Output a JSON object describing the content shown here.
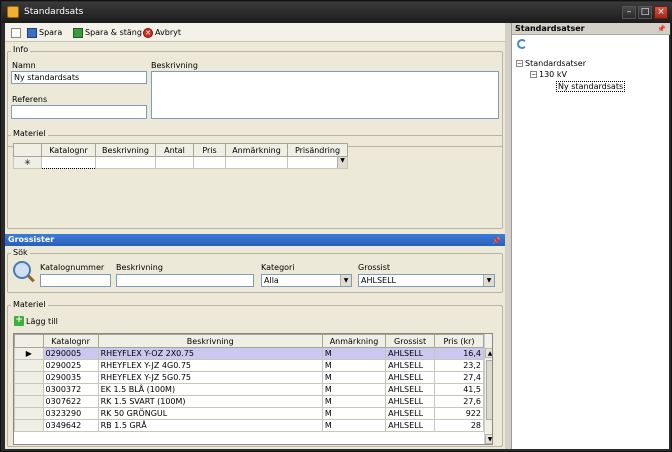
{
  "window": {
    "title": "Standardsats"
  },
  "toolbar": {
    "save_label": "Spara",
    "save_close_label": "Spara & stäng",
    "cancel_label": "Avbryt"
  },
  "info": {
    "legend": "Info",
    "name_label": "Namn",
    "name_value": "Ny standardsats",
    "desc_label": "Beskrivning",
    "ref_label": "Referens",
    "ref_value": ""
  },
  "materiel_top": {
    "legend": "Materiel",
    "columns": [
      "Katalognr",
      "Beskrivning",
      "Antal",
      "Pris",
      "Anmärkning",
      "Prisändring"
    ],
    "new_row_marker": "✳"
  },
  "grossister": {
    "title": "Grossister",
    "search": {
      "legend": "Sök",
      "catalog_label": "Katalognummer",
      "catalog_value": "",
      "desc_label": "Beskrivning",
      "desc_value": "",
      "category_label": "Kategori",
      "category_value": "Alla",
      "wholesaler_label": "Grossist",
      "wholesaler_value": "AHLSELL"
    },
    "materiel": {
      "legend": "Materiel",
      "add_label": "Lägg till",
      "columns": [
        "Katalognr",
        "Beskrivning",
        "Anmärkning",
        "Grossist",
        "Pris (kr)"
      ],
      "rows": [
        {
          "kat": "0290005",
          "desc": "RHEYFLEX Y-OZ 2X0.75",
          "anm": "M",
          "gross": "AHLSELL",
          "pris": "16,4"
        },
        {
          "kat": "0290025",
          "desc": "RHEYFLEX Y-JZ 4G0.75",
          "anm": "M",
          "gross": "AHLSELL",
          "pris": "23,2"
        },
        {
          "kat": "0290035",
          "desc": "RHEYFLEX Y-JZ 5G0.75",
          "anm": "M",
          "gross": "AHLSELL",
          "pris": "27,4"
        },
        {
          "kat": "0300372",
          "desc": "EK 1.5 BLÅ (100M)",
          "anm": "M",
          "gross": "AHLSELL",
          "pris": "41,5"
        },
        {
          "kat": "0307622",
          "desc": "RK 1.5 SVART    (100M)",
          "anm": "M",
          "gross": "AHLSELL",
          "pris": "27,6"
        },
        {
          "kat": "0323290",
          "desc": "RK 50 GRÖNGUL",
          "anm": "M",
          "gross": "AHLSELL",
          "pris": "922"
        },
        {
          "kat": "0349642",
          "desc": "RB 1.5 GRÅ",
          "anm": "M",
          "gross": "AHLSELL",
          "pris": "28"
        }
      ]
    }
  },
  "right_panel": {
    "title": "Standardsatser",
    "tree": {
      "root": "Standardsatser",
      "child": "130 kV",
      "leaf": "Ny standardsats"
    }
  },
  "colors": {
    "dock_header": "#2a5fb8",
    "selected_row": "#c8c8f0",
    "panel_bg": "#ece9d8"
  }
}
